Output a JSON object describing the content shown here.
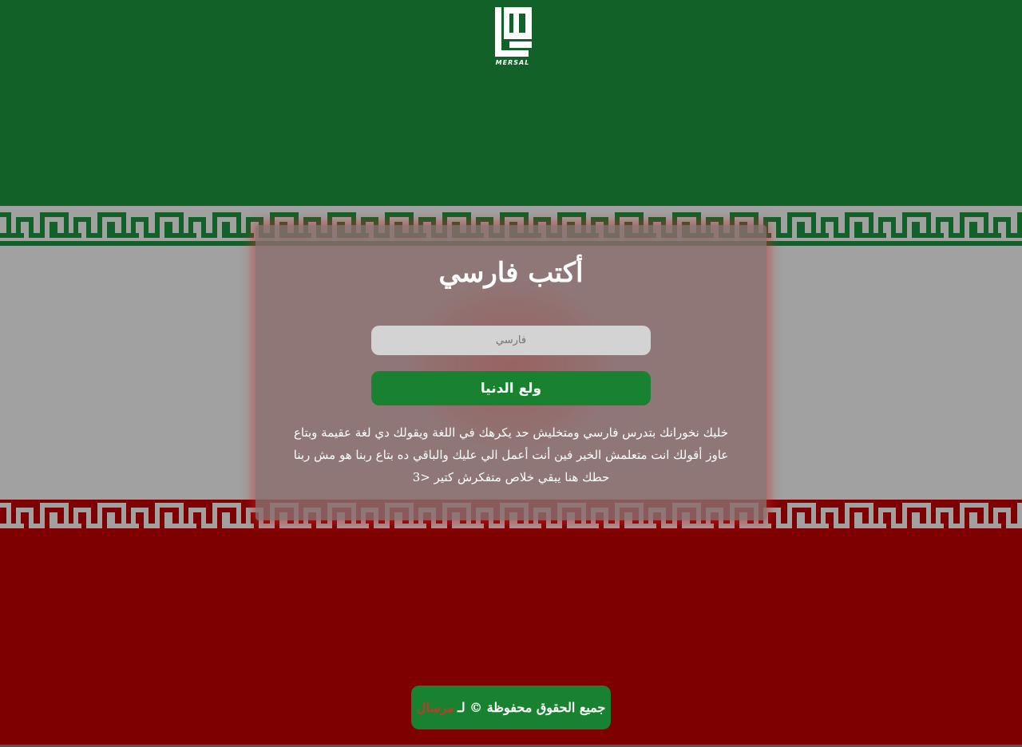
{
  "page": {
    "title": "أكتب فارسي"
  },
  "logo": {
    "caption": "MERSAL"
  },
  "form": {
    "input_placeholder": "فارسي",
    "input_value": "",
    "submit_label": "ولع الدنيا"
  },
  "description": "خليك نخورانك بتدرس فارسي ومتخليش حد يكرهك في اللغة ويقولك دي لغة عقيمة وبتاع عاوز أقولك انت متعلمش الخير فين أنت أعمل الي عليك والباقي ده بتاع ربنا هو مش ربنا حطك هنا يبقي خلاص متفكرش كتير <3",
  "footer": {
    "rights_text": "جميع الحقوق محفوظة © لـ",
    "brand": "مرسال"
  },
  "colors": {
    "green": "#116128",
    "white_band": "#a1a1a1",
    "red": "#7f0000",
    "button_green": "#188230",
    "brand_red": "#c0392b"
  },
  "icons": {
    "logo": "mersal-kufic-logo",
    "flag_pattern": "kufic-takbir-pattern"
  }
}
